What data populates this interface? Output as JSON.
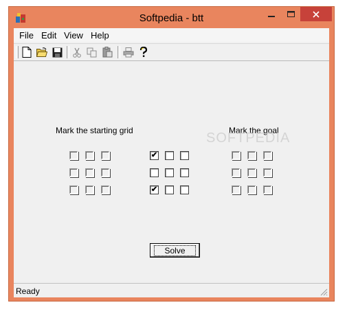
{
  "window": {
    "title": "Softpedia - btt"
  },
  "menu": [
    "File",
    "Edit",
    "View",
    "Help"
  ],
  "toolbar": {
    "buttons": [
      "new-icon",
      "open-icon",
      "save-icon",
      "cut-icon",
      "copy-icon",
      "paste-icon",
      "print-icon",
      "help-icon"
    ]
  },
  "main": {
    "start_label": "Mark the starting grid",
    "goal_label": "Mark the goal",
    "start_grid": [
      [
        false,
        false,
        false
      ],
      [
        false,
        false,
        false
      ],
      [
        false,
        false,
        false
      ]
    ],
    "middle_grid": [
      [
        true,
        false,
        false
      ],
      [
        false,
        false,
        false
      ],
      [
        true,
        false,
        false
      ]
    ],
    "goal_grid": [
      [
        false,
        false,
        false
      ],
      [
        false,
        false,
        false
      ],
      [
        false,
        false,
        false
      ]
    ],
    "solve_label": "Solve"
  },
  "status": {
    "text": "Ready"
  },
  "watermark": "SOFTPEDIA"
}
